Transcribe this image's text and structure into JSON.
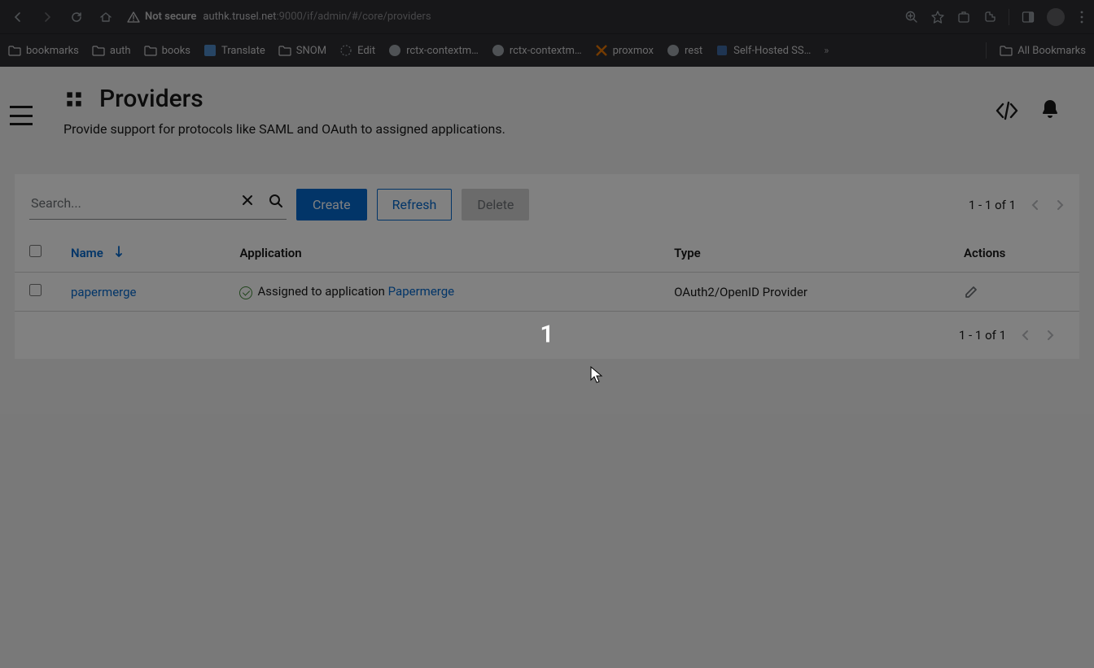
{
  "browser": {
    "not_secure_label": "Not secure",
    "url_host": "authk.trusel.net",
    "url_path": ":9000/if/admin/#/core/providers"
  },
  "bookmarks": {
    "items": [
      "bookmarks",
      "auth",
      "books",
      "Translate",
      "SNOM",
      "Edit",
      "rctx-contextm…",
      "rctx-contextm…",
      "proxmox",
      "rest",
      "Self-Hosted SS…"
    ],
    "all_label": "All Bookmarks"
  },
  "header": {
    "title": "Providers",
    "subtitle": "Provide support for protocols like SAML and OAuth to assigned applications."
  },
  "toolbar": {
    "search_placeholder": "Search...",
    "create_label": "Create",
    "refresh_label": "Refresh",
    "delete_label": "Delete"
  },
  "pagination": {
    "top_label": "1 - 1 of 1",
    "bottom_label": "1 - 1 of 1"
  },
  "table": {
    "columns": {
      "name": "Name",
      "application": "Application",
      "type": "Type",
      "actions": "Actions"
    },
    "rows": [
      {
        "name": "papermerge",
        "assigned_prefix": "Assigned to application ",
        "assigned_app": "Papermerge",
        "type": "OAuth2/OpenID Provider"
      }
    ]
  },
  "overlay": {
    "number": "1"
  }
}
